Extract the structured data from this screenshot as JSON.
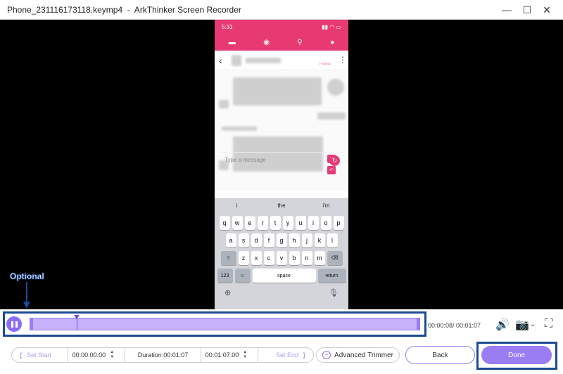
{
  "window": {
    "title": "Phone_231116173118.keymp4  -  ArkThinker Screen Recorder",
    "minimize": "—",
    "maximize": "☐",
    "close": "✕"
  },
  "phone": {
    "time": "5:31",
    "status_icons": "▮▮ ◠ ▭",
    "back_glyph": "‹",
    "more_glyph": "⋮",
    "badge": "TYOEND",
    "message_placeholder": "Type a message",
    "suggestions": [
      "i",
      "the",
      "i'm"
    ],
    "keys_row1": [
      "q",
      "w",
      "e",
      "r",
      "t",
      "y",
      "u",
      "i",
      "o",
      "p"
    ],
    "keys_row2": [
      "a",
      "s",
      "d",
      "f",
      "g",
      "h",
      "j",
      "k",
      "l"
    ],
    "keys_row3": [
      "z",
      "x",
      "c",
      "v",
      "b",
      "n",
      "m"
    ],
    "shift_glyph": "⇧",
    "delete_glyph": "⌫",
    "num_key": "123",
    "emoji_key": "☺",
    "space_key": "space",
    "return_key": "return",
    "globe_glyph": "⊕",
    "mic_glyph": "🎙"
  },
  "annotation": {
    "label": "Optional"
  },
  "timeline": {
    "timecode": "00:00:08/ 00:01:07",
    "playhead_fraction": 0.12
  },
  "controls": {
    "set_start": "Set Start",
    "start_time": "00:00:00.00",
    "duration": "Duration:00:01:07",
    "end_time": "00:01:07.00",
    "set_end": "Set End",
    "advanced_trimmer": "Advanced Trimmer",
    "back": "Back",
    "done": "Done"
  }
}
